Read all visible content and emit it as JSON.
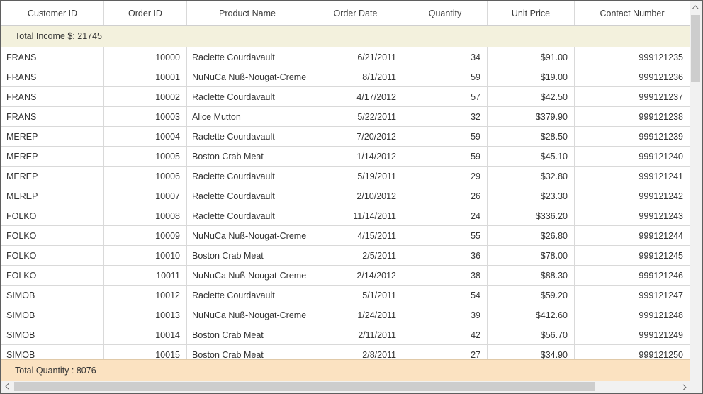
{
  "grid": {
    "columns": [
      {
        "key": "customer_id",
        "label": "Customer ID"
      },
      {
        "key": "order_id",
        "label": "Order ID"
      },
      {
        "key": "product_name",
        "label": "Product Name"
      },
      {
        "key": "order_date",
        "label": "Order Date"
      },
      {
        "key": "quantity",
        "label": "Quantity"
      },
      {
        "key": "unit_price",
        "label": "Unit Price"
      },
      {
        "key": "contact_number",
        "label": "Contact Number"
      }
    ],
    "top_summary": "Total Income $: 21745",
    "bottom_summary": "Total Quantity : 8076",
    "rows": [
      [
        "FRANS",
        "10000",
        "Raclette Courdavault",
        "6/21/2011",
        "34",
        "$91.00",
        "999121235"
      ],
      [
        "FRANS",
        "10001",
        "NuNuCa Nuß-Nougat-Creme",
        "8/1/2011",
        "59",
        "$19.00",
        "999121236"
      ],
      [
        "FRANS",
        "10002",
        "Raclette Courdavault",
        "4/17/2012",
        "57",
        "$42.50",
        "999121237"
      ],
      [
        "FRANS",
        "10003",
        "Alice Mutton",
        "5/22/2011",
        "32",
        "$379.90",
        "999121238"
      ],
      [
        "MEREP",
        "10004",
        "Raclette Courdavault",
        "7/20/2012",
        "59",
        "$28.50",
        "999121239"
      ],
      [
        "MEREP",
        "10005",
        "Boston Crab Meat",
        "1/14/2012",
        "59",
        "$45.10",
        "999121240"
      ],
      [
        "MEREP",
        "10006",
        "Raclette Courdavault",
        "5/19/2011",
        "29",
        "$32.80",
        "999121241"
      ],
      [
        "MEREP",
        "10007",
        "Raclette Courdavault",
        "2/10/2012",
        "26",
        "$23.30",
        "999121242"
      ],
      [
        "FOLKO",
        "10008",
        "Raclette Courdavault",
        "11/14/2011",
        "24",
        "$336.20",
        "999121243"
      ],
      [
        "FOLKO",
        "10009",
        "NuNuCa Nuß-Nougat-Creme",
        "4/15/2011",
        "55",
        "$26.80",
        "999121244"
      ],
      [
        "FOLKO",
        "10010",
        "Boston Crab Meat",
        "2/5/2011",
        "36",
        "$78.00",
        "999121245"
      ],
      [
        "FOLKO",
        "10011",
        "NuNuCa Nuß-Nougat-Creme",
        "2/14/2012",
        "38",
        "$88.30",
        "999121246"
      ],
      [
        "SIMOB",
        "10012",
        "Raclette Courdavault",
        "5/1/2011",
        "54",
        "$59.20",
        "999121247"
      ],
      [
        "SIMOB",
        "10013",
        "NuNuCa Nuß-Nougat-Creme",
        "1/24/2011",
        "39",
        "$412.60",
        "999121248"
      ],
      [
        "SIMOB",
        "10014",
        "Boston Crab Meat",
        "2/11/2011",
        "42",
        "$56.70",
        "999121249"
      ],
      [
        "SIMOB",
        "10015",
        "Boston Crab Meat",
        "2/8/2011",
        "27",
        "$34.90",
        "999121250"
      ]
    ]
  },
  "colors": {
    "top_summary_bg": "#f3f1dd",
    "bottom_summary_bg": "#fbe2c1",
    "grid_line": "#d9d9d9",
    "outer_border": "#5f5f5f",
    "scrollbar_track": "#f1f1f1",
    "scrollbar_thumb": "#cdcdcd",
    "text": "#363636"
  }
}
